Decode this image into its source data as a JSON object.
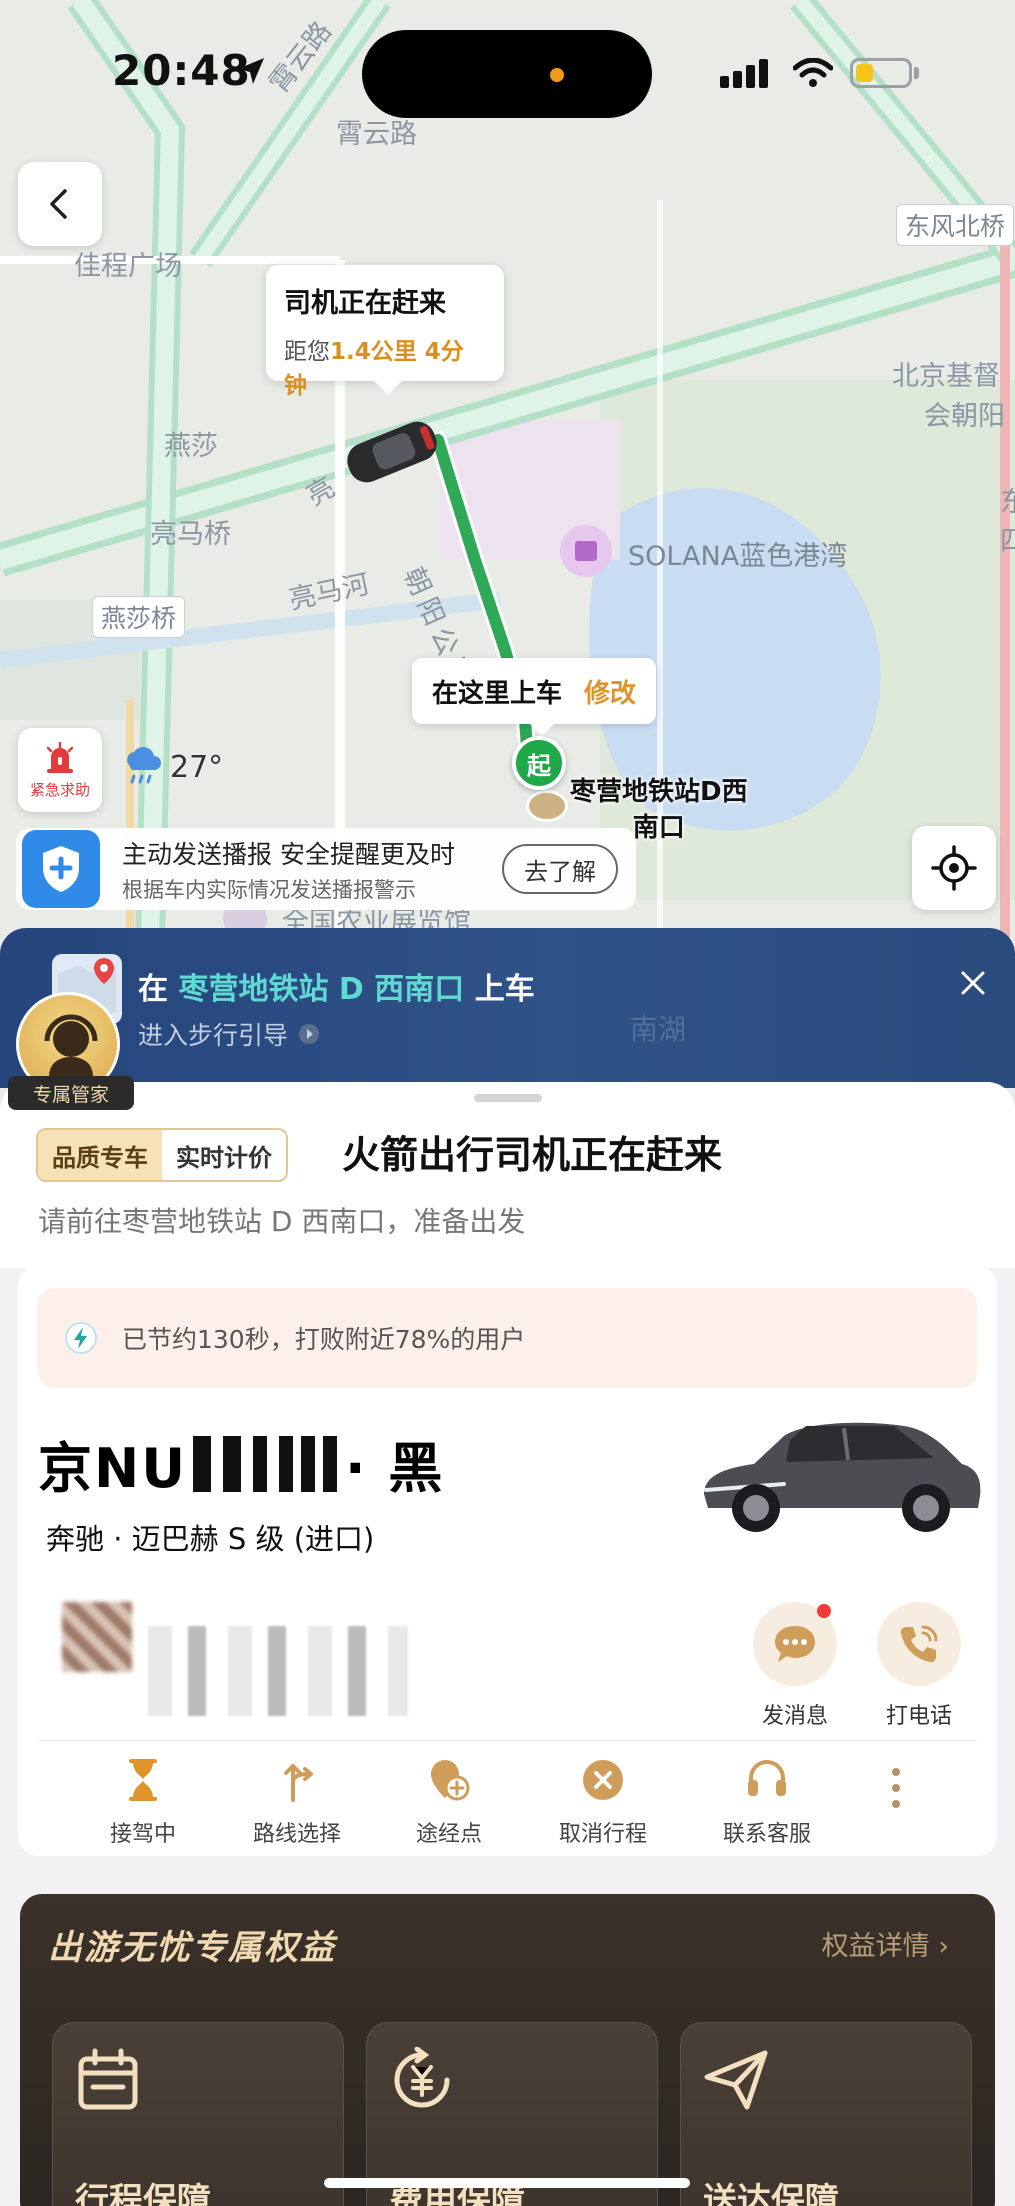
{
  "status_bar": {
    "time": "20:48"
  },
  "map": {
    "labels": {
      "xiaoyun_road_diag": "霄云路",
      "xiaoyun_road": "霄云路",
      "dongfeng_bridge": "东风北桥",
      "jiacheng_plaza": "佳程广场",
      "beijing_ji": "北京基督",
      "hui_chaoyang": "会朝阳",
      "yansha": "燕莎",
      "liangma_bridge": "亮马桥",
      "liangma_river": "亮马河",
      "yansha_bridge": "燕莎桥",
      "chaoyang_park_road": "朝阳公园路",
      "liang": "亮",
      "solana": "SOLANA蓝色港湾",
      "agri_hall": "全国农业展览馆",
      "east_edge": "东四"
    },
    "driver_callout": {
      "title": "司机正在赶来",
      "prefix": "距您",
      "distance": "1.4公里 4分钟"
    },
    "pickup_callout": {
      "text": "在这里上车",
      "edit": "修改"
    },
    "start_pin": "起",
    "station_label_line1": "枣营地铁站D西",
    "station_label_line2": "南口",
    "sos_label": "紧急求助",
    "weather_temp": "27°",
    "safety": {
      "title": "主动发送播报 安全提醒更及时",
      "subtitle": "根据车内实际情况发送播报警示",
      "button": "去了解"
    }
  },
  "nav_banner": {
    "prefix": "在",
    "station": "枣营地铁站 D 西南口",
    "suffix": "上车",
    "sub": "进入步行引导",
    "faint_label": "南湖",
    "concierge_tag": "专属管家"
  },
  "trip": {
    "tag_primary": "品质专车",
    "tag_secondary": "实时计价",
    "title": "火箭出行司机正在赶来",
    "subtitle": "请前往枣营地铁站 D 西南口，准备出发",
    "saving": "已节约130秒，打败附近78%的用户",
    "plate_prefix": "京NU",
    "plate_suffix": "· 黑",
    "car_model": "奔驰 · 迈巴赫 S 级 (进口)",
    "contact_message": "发消息",
    "contact_call": "打电话",
    "actions": [
      {
        "label": "接驾中"
      },
      {
        "label": "路线选择"
      },
      {
        "label": "途经点"
      },
      {
        "label": "取消行程"
      },
      {
        "label": "联系客服"
      }
    ]
  },
  "benefits": {
    "title": "出游无忧专属权益",
    "link": "权益详情 ›",
    "items": [
      {
        "label": "行程保障"
      },
      {
        "label": "费用保障"
      },
      {
        "label": "送达保障"
      }
    ]
  },
  "colors": {
    "accent_gold": "#e0932a",
    "route_green": "#1fa84a",
    "banner_blue": "#2f5287",
    "highlight_teal": "#5fd9d2"
  }
}
